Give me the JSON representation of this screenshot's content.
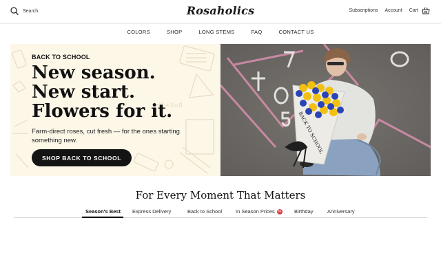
{
  "header": {
    "search_label": "Search",
    "logo": "Rosaholics",
    "subscriptions": "Subscriptions",
    "account": "Account",
    "cart": "Cart"
  },
  "nav": {
    "items": [
      "COLORS",
      "SHOP",
      "LONG STEMS",
      "FAQ",
      "CONTACT US"
    ]
  },
  "hero": {
    "eyebrow": "BACK TO SCHOOL",
    "headline": [
      "New season.",
      "New start.",
      "Flowers for it."
    ],
    "subtext": "Farm-direct roses, cut fresh — for the ones starting something new.",
    "cta": "SHOP BACK TO SCHOOL",
    "bouquet_text": "BACK TO SCHOOL",
    "background_color": "#fdf7e8",
    "photo_ground_color": "#6c6867",
    "chalk_color": "#d98fae"
  },
  "section": {
    "title": "For Every Moment That Matters",
    "tabs": [
      "Season's Best",
      "Express Delivery",
      "Back to School",
      "In Season Prices",
      "Birthday",
      "Anniversary"
    ],
    "active_tab": "Season's Best",
    "badge_color": "#e0393e"
  }
}
